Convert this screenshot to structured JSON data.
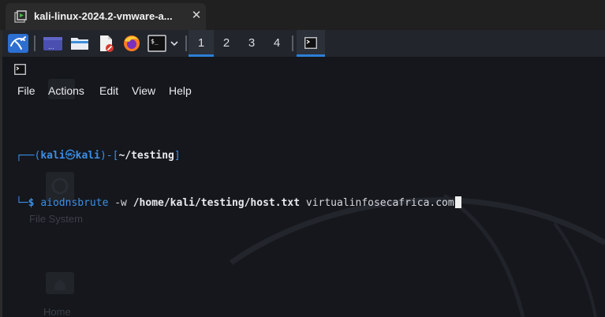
{
  "host_tab": {
    "title": "kali-linux-2024.2-vmware-a...",
    "close_glyph": "✕",
    "icon": "vmware-vm-icon"
  },
  "panel": {
    "workspaces": [
      "1",
      "2",
      "3",
      "4"
    ],
    "active_workspace": "1",
    "icons": [
      "kali-menu-icon",
      "show-desktop-icon",
      "file-manager-icon",
      "text-editor-icon",
      "firefox-icon",
      "terminal-icon",
      "chevron-down-icon",
      "terminal-task-icon"
    ]
  },
  "terminal": {
    "menu": [
      "File",
      "Actions",
      "Edit",
      "View",
      "Help"
    ],
    "prompt": {
      "open": "┌──(",
      "user": "kali",
      "at_symbol": "㉿",
      "host": "kali",
      "mid": ")-[",
      "cwd": "~/testing",
      "close": "]",
      "line2_prefix": "└─",
      "dollar": "$"
    },
    "command": {
      "program": "aiodnsbrute",
      "flag": "-w",
      "path": "/home/kali/testing/host.txt",
      "target": "virtualinfosecafrica.com"
    }
  },
  "desktop_background": {
    "labels": [
      "File System",
      "Home"
    ]
  },
  "colors": {
    "accent": "#2d7fd6",
    "prompt_blue": "#3a8fe8",
    "terminal_bg": "#15171c",
    "panel_bg": "#22252b"
  }
}
